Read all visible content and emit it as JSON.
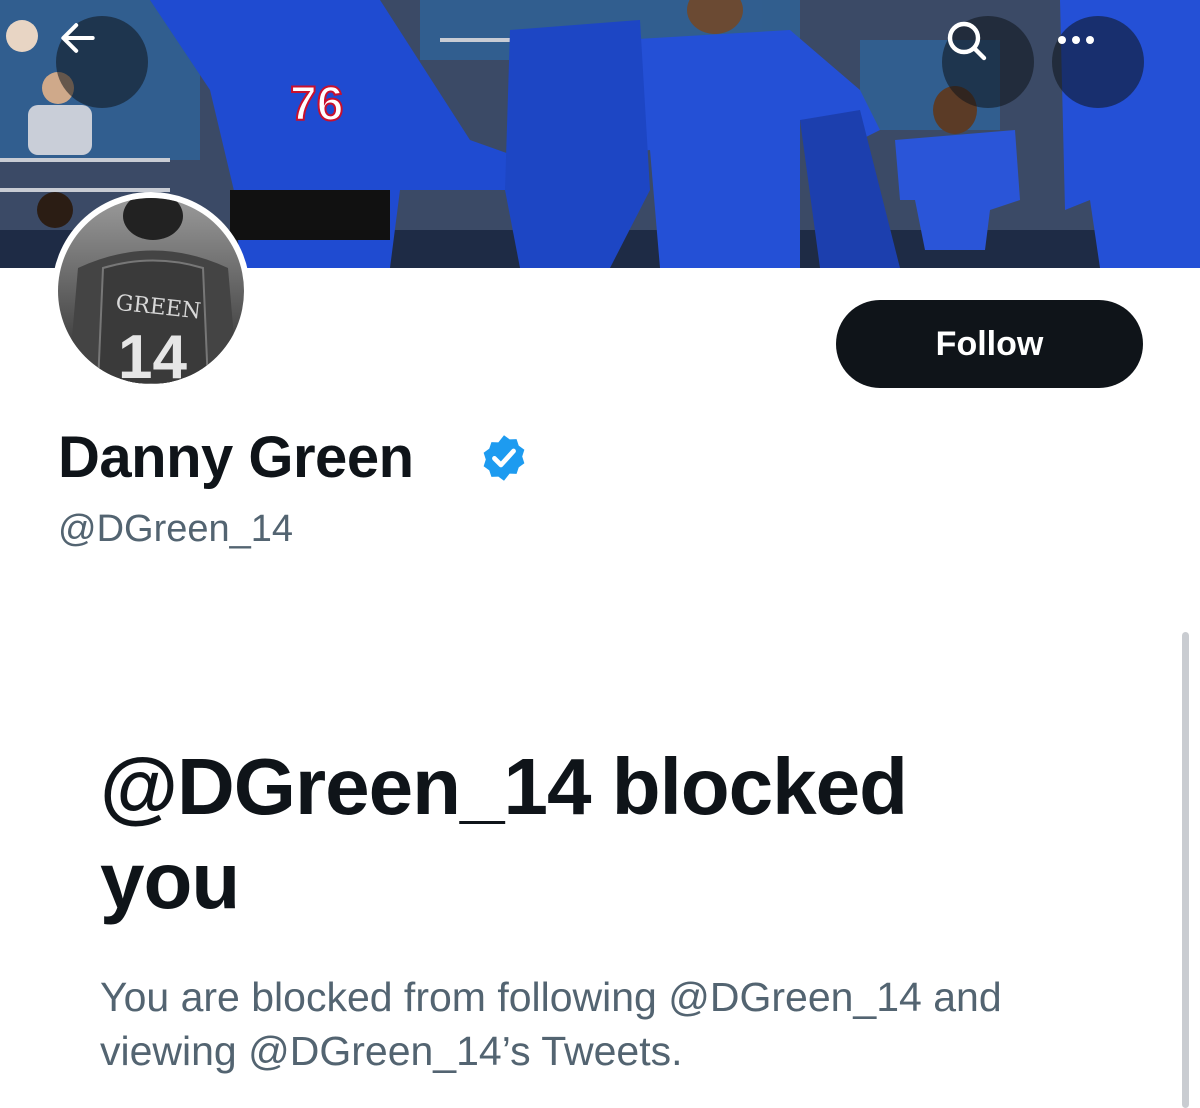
{
  "header": {
    "back_icon": "arrow-left-icon",
    "search_icon": "search-icon",
    "more_icon": "more-horizontal-icon",
    "banner_jersey_number": "76"
  },
  "profile": {
    "display_name": "Danny Green",
    "handle": "@DGreen_14",
    "verified": true,
    "verified_color": "#1d9bf0",
    "avatar_jersey_name": "GREEN",
    "avatar_jersey_number": "14",
    "follow_label": "Follow"
  },
  "blocked": {
    "title": "@DGreen_14 blocked you",
    "description": "You are blocked from following @DGreen_14 and viewing @DGreen_14’s Tweets."
  },
  "colors": {
    "primary_text": "#0f1419",
    "secondary_text": "#536471",
    "button_bg": "#0f1419"
  }
}
